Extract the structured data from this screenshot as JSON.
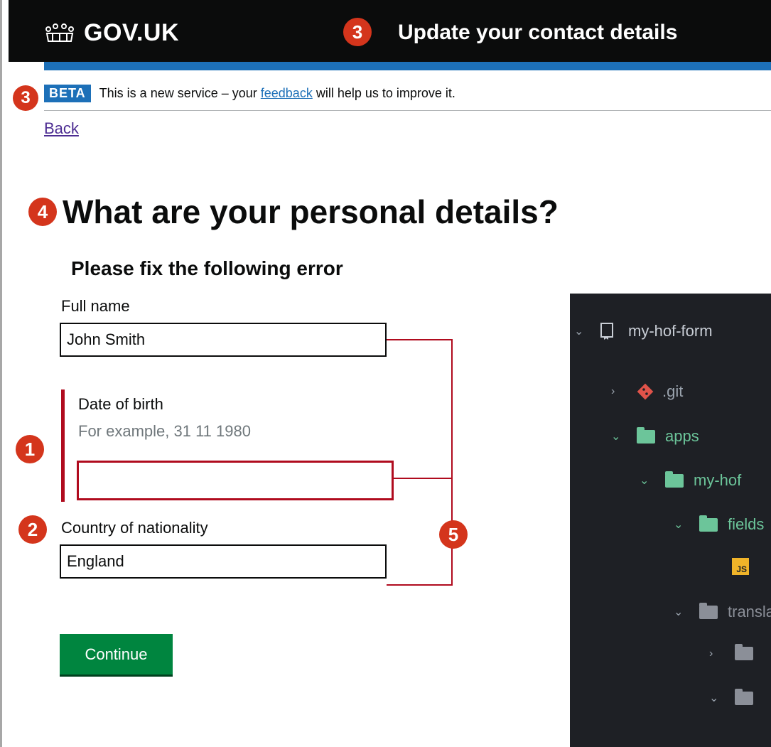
{
  "header": {
    "logo_text": "GOV.UK",
    "service_name": "Update your contact details"
  },
  "phase_banner": {
    "tag": "BETA",
    "text_before": "This is a new service – your ",
    "link": "feedback",
    "text_after": " will help us to improve it."
  },
  "back_link": "Back",
  "page_title": "What are your personal details?",
  "error_summary": {
    "heading": "Please fix the following error"
  },
  "fields": {
    "full_name": {
      "label": "Full name",
      "value": "John Smith"
    },
    "date_of_birth": {
      "label": "Date of birth",
      "hint": "For example, 31 11 1980",
      "value": ""
    },
    "nationality": {
      "label": "Country of nationality",
      "value": "England"
    }
  },
  "continue_button": "Continue",
  "annotations": {
    "header": "3",
    "phase": "3",
    "title": "4",
    "error": "1",
    "nationality": "2",
    "fields": "5"
  },
  "file_tree": {
    "root": "my-hof-form",
    "git": ".git",
    "apps": "apps",
    "app": "my-hof",
    "fields": "fields",
    "translations": "translations"
  },
  "colors": {
    "header_bg": "#0b0c0c",
    "brand_blue": "#1d70b8",
    "error_red": "#b00b1e",
    "button_green": "#00853f",
    "annotation_red": "#d4351c"
  }
}
